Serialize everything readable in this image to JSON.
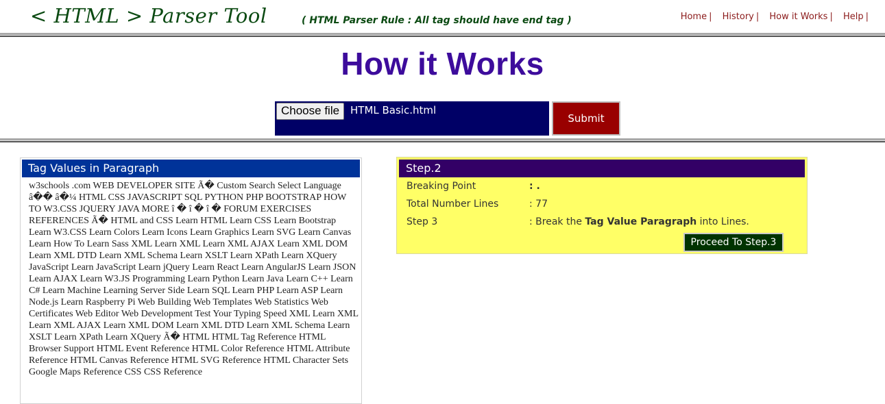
{
  "header": {
    "brand": "< HTML > Parser Tool",
    "rule_note": "( HTML Parser Rule : All tag should have end tag )",
    "nav": [
      {
        "label": "Home"
      },
      {
        "label": "History"
      },
      {
        "label": "How it Works"
      },
      {
        "label": "Help"
      }
    ],
    "nav_separator": "|"
  },
  "page": {
    "title": "How it Works"
  },
  "upload": {
    "choose_label": "Choose file",
    "file_name": "HTML Basic.html",
    "submit_label": "Submit"
  },
  "tag_panel": {
    "title": "Tag Values in Paragraph",
    "text": "w3schools .com WEB DEVELOPER SITE Ã�   Custom Search Select Language â�� â�¼ HTML CSS JAVASCRIPT SQL PYTHON PHP BOOTSTRAP HOW TO W3.CSS JQUERY JAVA MORE î � î � î � FORUM EXERCISES REFERENCES Ã� HTML and CSS Learn HTML Learn CSS Learn Bootstrap Learn W3.CSS Learn Colors Learn Icons Learn Graphics Learn SVG Learn Canvas Learn How To Learn Sass XML Learn XML Learn XML AJAX Learn XML DOM Learn XML DTD Learn XML Schema Learn XSLT Learn XPath Learn XQuery JavaScript Learn JavaScript Learn jQuery Learn React Learn AngularJS Learn JSON Learn AJAX Learn W3.JS Programming Learn Python Learn Java Learn C++ Learn C# Learn Machine Learning Server Side Learn SQL Learn PHP Learn ASP Learn Node.js Learn Raspberry Pi Web Building Web Templates Web Statistics Web Certificates Web Editor Web Development Test Your Typing Speed XML Learn XML Learn XML AJAX Learn XML DOM Learn XML DTD Learn XML Schema Learn XSLT Learn XPath Learn XQuery Ã� HTML HTML Tag Reference HTML Browser Support HTML Event Reference HTML Color Reference HTML Attribute Reference HTML Canvas Reference HTML SVG Reference HTML Character Sets Google Maps Reference CSS CSS Reference"
  },
  "step_panel": {
    "title": "Step.2",
    "rows": [
      {
        "label": "Breaking Point",
        "value": ": ."
      },
      {
        "label": "Total Number Lines",
        "value": ": 77"
      },
      {
        "label": "Step 3",
        "value_prefix": ": Break the ",
        "value_bold": "Tag Value Paragraph",
        "value_suffix": " into Lines."
      }
    ],
    "proceed_label": "Proceed To Step.3"
  },
  "colors": {
    "brand_green": "#0b4a12",
    "nav_red": "#8b1a1a",
    "title_purple": "#3d0c9c",
    "upload_navy": "#000066",
    "submit_red": "#990000",
    "tag_header_blue": "#003399",
    "step_header_purple": "#330066",
    "step_bg_yellow": "#ffff66",
    "proceed_green": "#003300"
  }
}
